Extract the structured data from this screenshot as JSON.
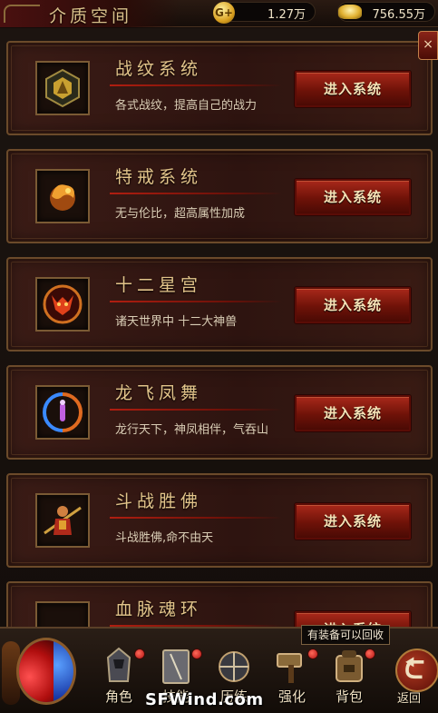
{
  "header": {
    "title": "介质空间",
    "gold_value": "1.27万",
    "ingot_value": "756.55万"
  },
  "close_label": "×",
  "systems": [
    {
      "name": "战纹系统",
      "desc": "各式战纹，提高自己的战力",
      "button": "进入系统",
      "icon": "war-pattern-icon"
    },
    {
      "name": "特戒系统",
      "desc": "无与伦比，超高属性加成",
      "button": "进入系统",
      "icon": "special-ring-icon"
    },
    {
      "name": "十二星宫",
      "desc": "诸天世界中 十二大神兽",
      "button": "进入系统",
      "icon": "zodiac-beast-icon"
    },
    {
      "name": "龙飞凤舞",
      "desc": "龙行天下，神凤相伴，气吞山",
      "button": "进入系统",
      "icon": "dragon-phoenix-icon"
    },
    {
      "name": "斗战胜佛",
      "desc": "斗战胜佛,命不由天",
      "button": "进入系统",
      "icon": "monkey-king-icon"
    },
    {
      "name": "血脉魂环",
      "desc": "",
      "button": "进入系统",
      "icon": "blood-ring-icon"
    }
  ],
  "bottom_nav": [
    {
      "label": "角色",
      "icon": "character-icon"
    },
    {
      "label": "技能",
      "icon": "skill-book-icon"
    },
    {
      "label": "历练",
      "icon": "training-icon"
    },
    {
      "label": "强化",
      "icon": "hammer-icon"
    },
    {
      "label": "背包",
      "icon": "backpack-icon"
    }
  ],
  "tooltip": "有装备可以回收",
  "back_label": "返回",
  "watermark": "SFWind.com",
  "colors": {
    "button_red": "#a8281a",
    "frame_gold": "#7a5a34",
    "card_bg": "#2e1410",
    "title_gold": "#e2c48a"
  }
}
